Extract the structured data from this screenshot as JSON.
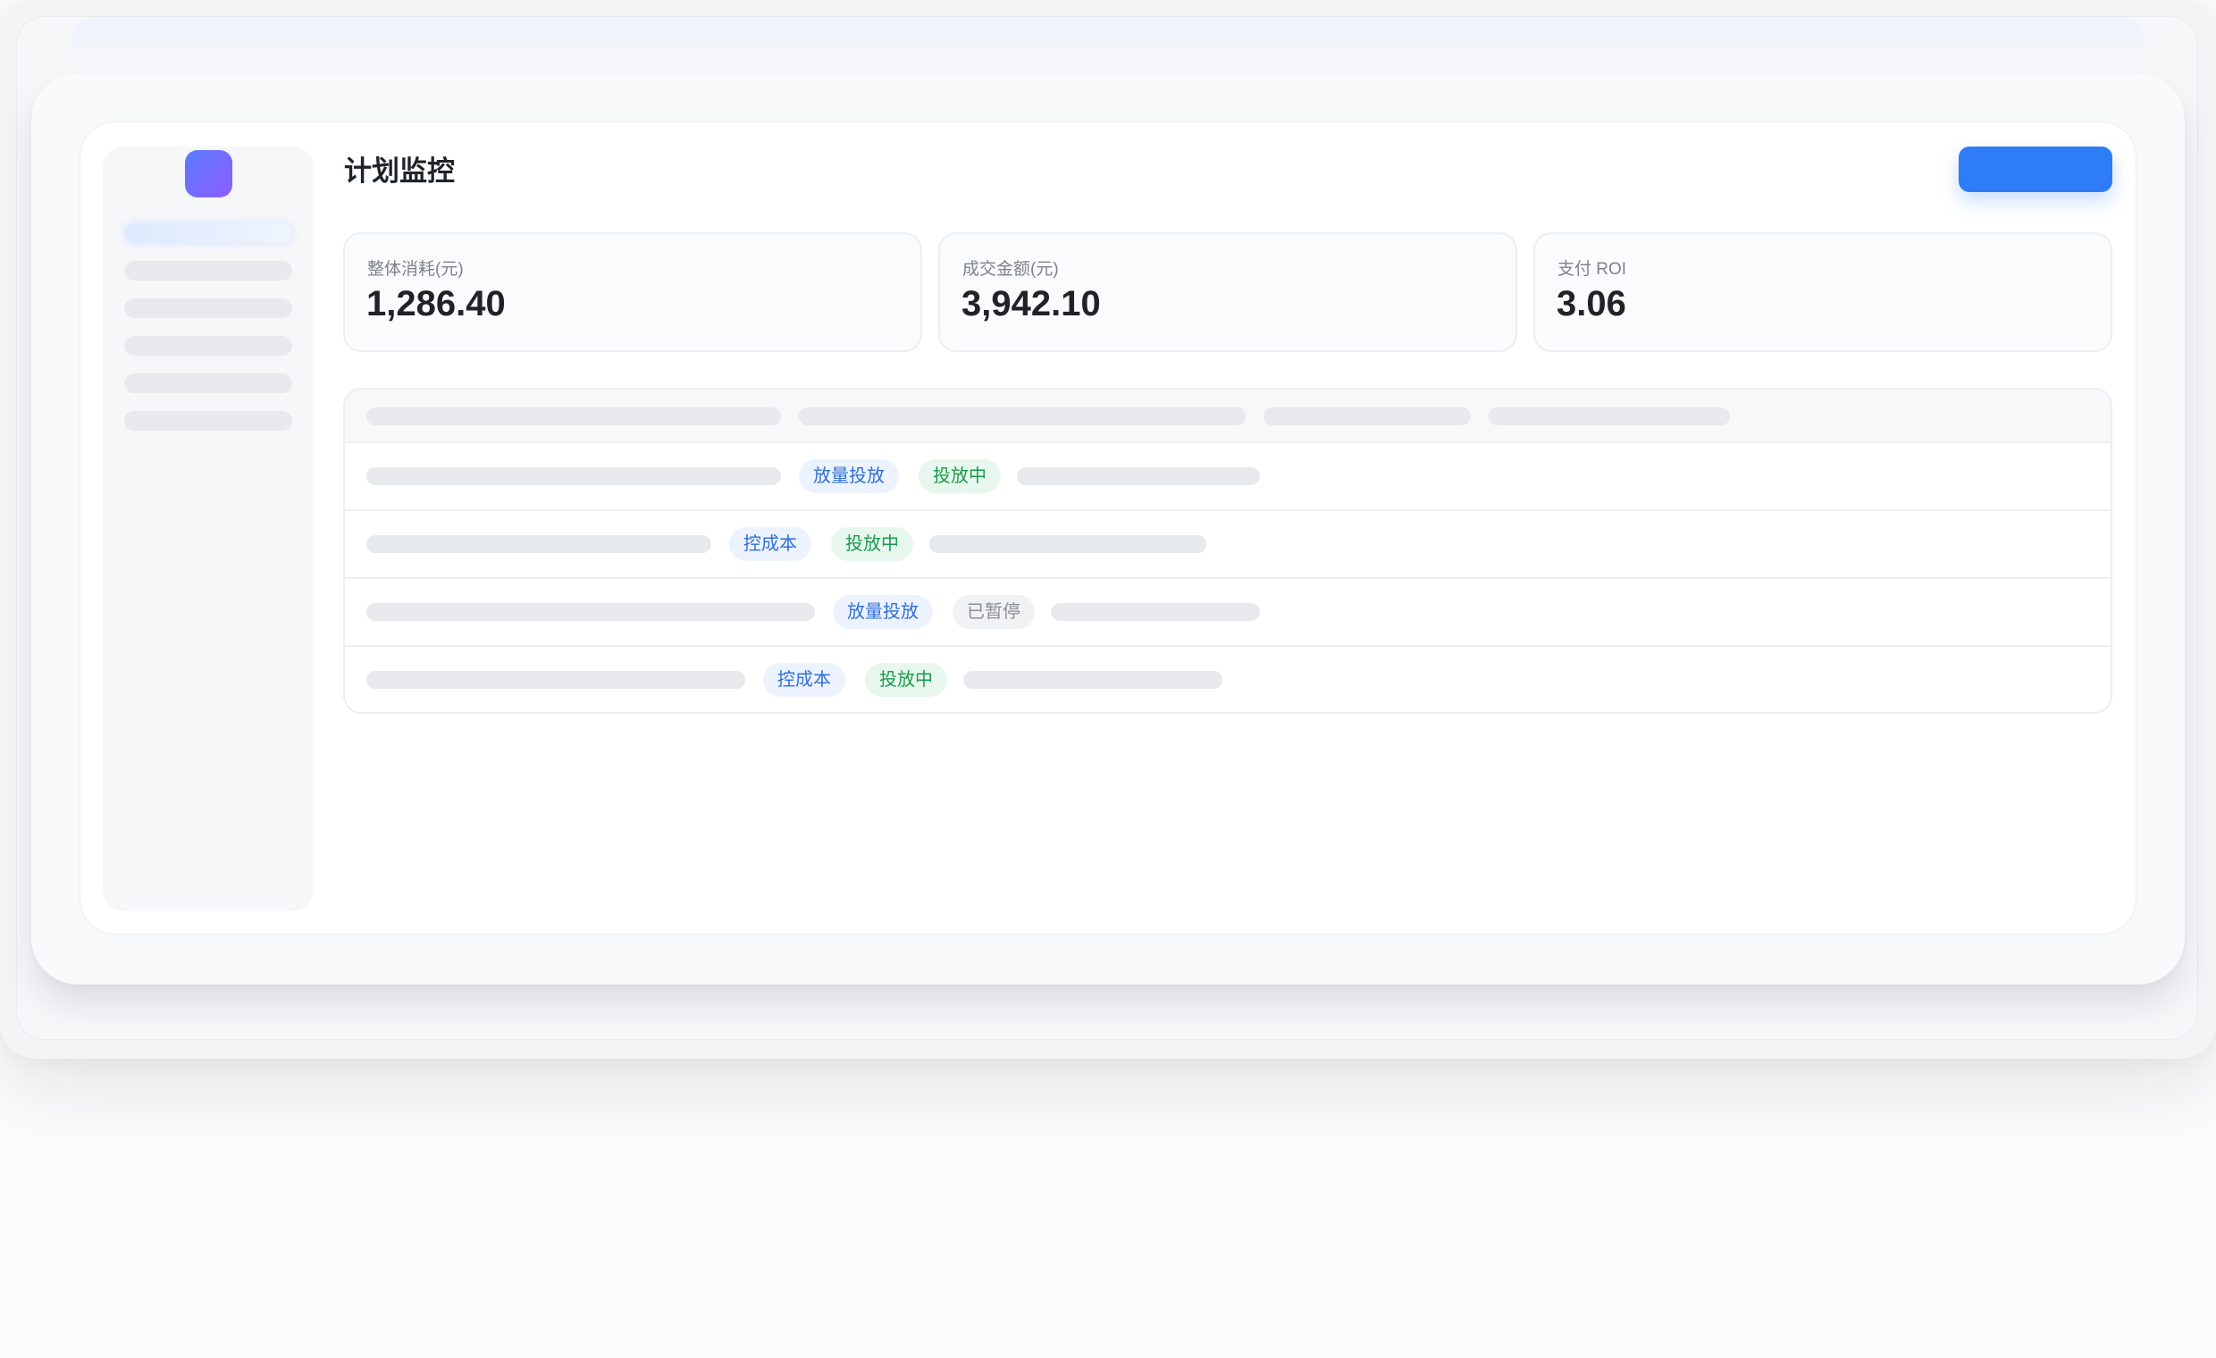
{
  "page": {
    "title": "计划监控"
  },
  "header": {
    "primary_action_label": ""
  },
  "kpis": [
    {
      "label": "整体消耗(元)",
      "value": "1,286.40"
    },
    {
      "label": "成交金额(元)",
      "value": "3,942.10"
    },
    {
      "label": "支付 ROI",
      "value": "3.06"
    }
  ],
  "table": {
    "rows": [
      {
        "type_tag": "放量投放",
        "status_tag": "投放中"
      },
      {
        "type_tag": "控成本",
        "status_tag": "投放中"
      },
      {
        "type_tag": "放量投放",
        "status_tag": "已暂停"
      },
      {
        "type_tag": "控成本",
        "status_tag": "投放中"
      }
    ]
  },
  "colors": {
    "accent": "#2f7df6",
    "logo_gradient_start": "#5b7cff",
    "logo_gradient_end": "#8c5cff",
    "tag_type": "#2f6fd6",
    "tag_running": "#1c9a4e",
    "tag_paused": "#8a8f97"
  }
}
